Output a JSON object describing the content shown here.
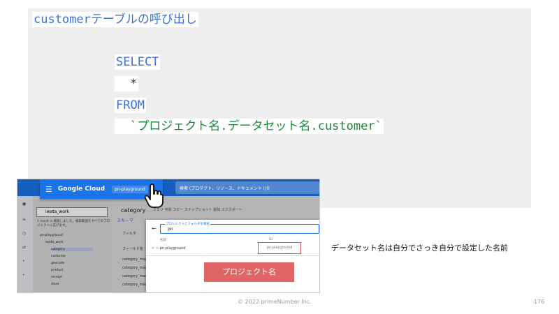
{
  "code": {
    "title": "customerテーブルの呼び出し",
    "select": "SELECT",
    "star": "*",
    "from": "FROM",
    "table_ref": "`プロジェクト名.データセット名.customer`"
  },
  "screenshot": {
    "logo": "Google Cloud",
    "project_selector": "pn-playground",
    "search_placeholder": "検索 (プロダクト、リソース、ドキュメント (/))",
    "explorer_search": "iwata_work",
    "explorer_note": "1 result is 検索しました。検索範囲をすべてのプロジェクトに広げます。",
    "tree": [
      "pn-playground",
      "iwata_work",
      "category",
      "customer",
      "geocode",
      "product",
      "receipt",
      "store"
    ],
    "main_title": "category",
    "tabs": "クエリ  共有  コピー  スナップショット  削除  エクスポート",
    "schema_tab": "スキーマ",
    "filter_label": "フィルタ",
    "field_label": "フィールド名",
    "columns": [
      "category_major",
      "category_major",
      "category_medium",
      "category_medium"
    ],
    "dialog_field_label": "プロジェクトとフォルダを検索",
    "dialog_field_value": "pn",
    "dialog_head_name": "名前",
    "dialog_head_id": "ID",
    "dialog_row_name": "pn-playground",
    "dialog_row_id": "pn-playground"
  },
  "button_label": "プロジェクト名",
  "annotation": "データセット名は自分でさっき自分で設定した名前",
  "footer": "© 2022 primeNumber Inc.",
  "page_number": "176"
}
